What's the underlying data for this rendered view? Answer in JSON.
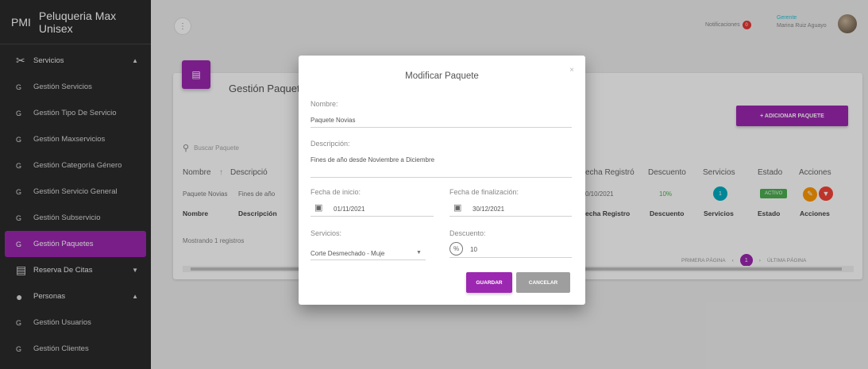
{
  "sidebar": {
    "brand_abbr": "PMI",
    "brand_name": "Peluqueria Max Unisex",
    "items": [
      {
        "icon": "X",
        "label": "Servicios"
      },
      {
        "icon": "G",
        "label": "Gestión Servicios"
      },
      {
        "icon": "G",
        "label": "Gestión Tipo De Servicio"
      },
      {
        "icon": "G",
        "label": "Gestión Maxservicios"
      },
      {
        "icon": "G",
        "label": "Gestión Categoría Género"
      },
      {
        "icon": "G",
        "label": "Gestión Servicio General"
      },
      {
        "icon": "G",
        "label": "Gestión Subservicio"
      },
      {
        "icon": "G",
        "label": "Gestión Paquetes"
      },
      {
        "icon": "▤",
        "label": "Reserva De Citas"
      },
      {
        "icon": "●",
        "label": "Personas"
      },
      {
        "icon": "G",
        "label": "Gestión Usuarios"
      },
      {
        "icon": "G",
        "label": "Gestión Clientes"
      }
    ]
  },
  "topbar": {
    "menu_glyph": "⋮",
    "notifications_label": "Notificaciones",
    "notifications_count": "0",
    "user_role": "Gerente",
    "user_name": "Marina Ruiz Aguayo"
  },
  "card": {
    "title": "Gestión Paquetes",
    "add_button": "+ ADICIONAR PAQUETE",
    "search_placeholder": "Buscar Paquete",
    "header": {
      "nombre": "Nombre",
      "descripcion": "Descripció",
      "fecha_registro": "echa Registró",
      "descuento": "Descuento",
      "servicios": "Servicios",
      "estado": "Estado",
      "acciones": "Acciones"
    },
    "row": {
      "nombre": "Paquete Novias",
      "descripcion": "Fines de año",
      "fecha_registro": "0/10/2021",
      "descuento": "10%",
      "servicios": "1",
      "estado": "ACTIVO"
    },
    "footer": {
      "nombre": "Nombre",
      "descripcion": "Descripción",
      "fecha_registro": "echa Registro",
      "descuento": "Descuento",
      "servicios": "Servicios",
      "estado": "Estado",
      "acciones": "Acciones"
    },
    "showing": "Mostrando 1 registros",
    "pager": {
      "first": "PRIMERA PÁGINA",
      "current": "1",
      "last": "ÚLTIMA PÁGINA"
    }
  },
  "modal": {
    "title": "Modificar Paquete",
    "close_glyph": "×",
    "nombre_label": "Nombre:",
    "nombre_value": "Paquete Novias",
    "descripcion_label": "Descripción:",
    "descripcion_value": "Fines de año desde Noviembre a Diciembre",
    "fecha_inicio_label": "Fecha de inicio:",
    "fecha_inicio_value": "01/11/2021",
    "fecha_fin_label": "Fecha de finalización:",
    "fecha_fin_value": "30/12/2021",
    "servicios_label": "Servicios:",
    "servicios_value": "Corte Desmechado - Muje",
    "descuento_label": "Descuento:",
    "descuento_value": "10",
    "save_button": "GUARDAR",
    "cancel_button": "CANCELAR"
  },
  "colors": {
    "accent": "#9c27b0",
    "sidebar_bg": "#2b2b2b",
    "active_badge": "#4caf50",
    "info_badge": "#00acc1",
    "edit": "#ff9800",
    "delete": "#f44336"
  }
}
